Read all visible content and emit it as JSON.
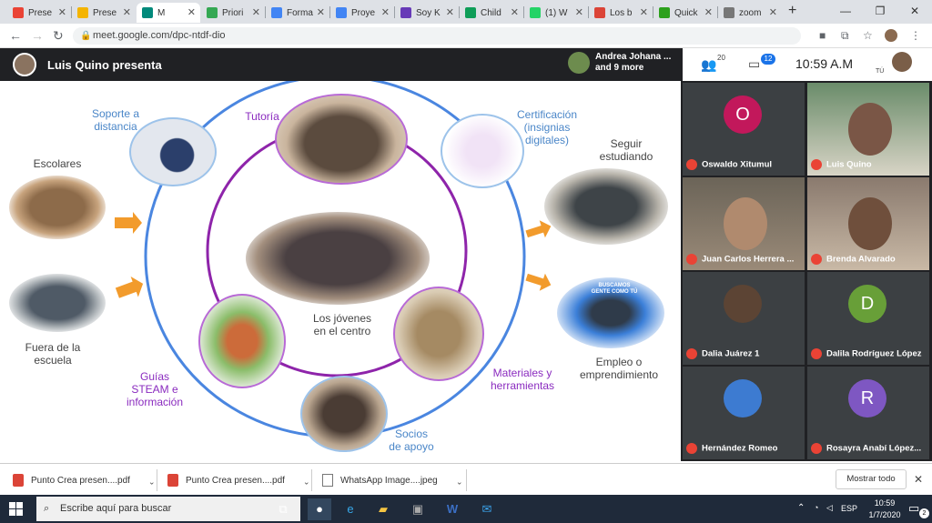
{
  "browser": {
    "tabs": [
      {
        "label": "Prese",
        "icon": "gmail-icon",
        "color": "#ea4335"
      },
      {
        "label": "Prese",
        "icon": "slides-icon",
        "color": "#f4b400"
      },
      {
        "label": "M",
        "icon": "meet-icon",
        "color": "#00897b",
        "active": true
      },
      {
        "label": "Priori",
        "icon": "drive-icon",
        "color": "#34a853"
      },
      {
        "label": "Forma",
        "icon": "docs-icon",
        "color": "#4285f4"
      },
      {
        "label": "Proye",
        "icon": "docs-icon",
        "color": "#4285f4"
      },
      {
        "label": "Soy K",
        "icon": "forms-icon",
        "color": "#673ab7"
      },
      {
        "label": "Child",
        "icon": "sheets-icon",
        "color": "#0f9d58"
      },
      {
        "label": "(1) W",
        "icon": "whatsapp-icon",
        "color": "#25d366"
      },
      {
        "label": "Los b",
        "icon": "chrome-icon",
        "color": "#db4437"
      },
      {
        "label": "Quick",
        "icon": "quick-icon",
        "color": "#2ca01c"
      },
      {
        "label": "zoom",
        "icon": "globe-icon",
        "color": "#777777"
      }
    ],
    "new_tab": "+",
    "window_controls": [
      "—",
      "❐",
      "✕"
    ],
    "url": "meet.google.com/dpc-ntdf-dio"
  },
  "meet": {
    "presenter": "Luis Quino presenta",
    "others_line1": "Andrea Johana ...",
    "others_line2": "and 9 more",
    "participants_count": "20",
    "chat_count": "12",
    "time": "10:59 A.M",
    "you_label": "TÚ"
  },
  "slide": {
    "soporte": "Soporte a\ndistancia",
    "tutoria": "Tutoría",
    "certificacion": "Certificación\n(insignias\ndigitales)",
    "escolares": "Escolares",
    "fuera": "Fuera de la\nescuela",
    "centro": "Los jóvenes\nen el centro",
    "seguir": "Seguir\nestudiando",
    "empleo": "Empleo o\nemprendimiento",
    "guias": "Guías\nSTEAM e\ninformación",
    "materiales": "Materiales y\nherramientas",
    "socios": "Socios\nde apoyo",
    "banner_text": "BUSCAMOS\nGENTE COMO TÚ"
  },
  "participants": [
    {
      "name": "Oswaldo Xitumul",
      "letter": "O",
      "color": "#c2185b"
    },
    {
      "name": "Luis Quino",
      "letter": "",
      "color": ""
    },
    {
      "name": "Juan Carlos Herrera ...",
      "letter": "",
      "color": ""
    },
    {
      "name": "Brenda Alvarado",
      "letter": "",
      "color": ""
    },
    {
      "name": "Dalia Juárez 1",
      "letter": "",
      "color": ""
    },
    {
      "name": "Dalila Rodríguez López",
      "letter": "D",
      "color": "#689f38"
    },
    {
      "name": "Hernández Romeo",
      "letter": "",
      "color": ""
    },
    {
      "name": "Rosayra Anabí López...",
      "letter": "R",
      "color": "#7e57c2"
    }
  ],
  "downloads": {
    "items": [
      {
        "name": "Punto Crea presen....pdf",
        "type": "pdf"
      },
      {
        "name": "Punto Crea presen....pdf",
        "type": "pdf"
      },
      {
        "name": "WhatsApp Image....jpeg",
        "type": "image"
      }
    ],
    "show_all": "Mostrar todo"
  },
  "taskbar": {
    "search_placeholder": "Escribe aquí para buscar",
    "language": "ESP",
    "time": "10:59",
    "date": "1/7/2020",
    "notifications": "2"
  }
}
